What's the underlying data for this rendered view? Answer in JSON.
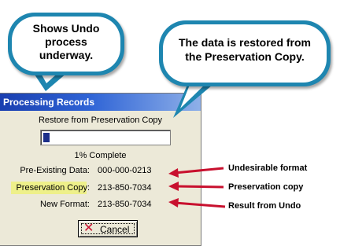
{
  "callouts": {
    "undo": {
      "text_line1": "Shows Undo",
      "text_line2": "process",
      "text_line3": "underway."
    },
    "restore": {
      "text_line1": "The data is restored from",
      "text_line2": "the Preservation Copy."
    }
  },
  "dialog": {
    "title": "Processing Records",
    "status": "Restore from Preservation Copy",
    "progress": {
      "percent": 1,
      "label": "1% Complete"
    },
    "rows": [
      {
        "label": "Pre-Existing Data:",
        "value": "000-000-0213"
      },
      {
        "label": "Preservation Copy:",
        "value": "213-850-7034"
      },
      {
        "label": "New Format:",
        "value": "213-850-7034"
      }
    ],
    "cancel_label": "Cancel"
  },
  "annotations": [
    "Undesirable format",
    "Preservation copy",
    "Result from Undo"
  ],
  "colors": {
    "callout_border": "#1e86b0",
    "arrow": "#c8102e",
    "highlight": "#eef08a",
    "titlebar": "#2f64d6",
    "progress": "#1c2f8a"
  }
}
